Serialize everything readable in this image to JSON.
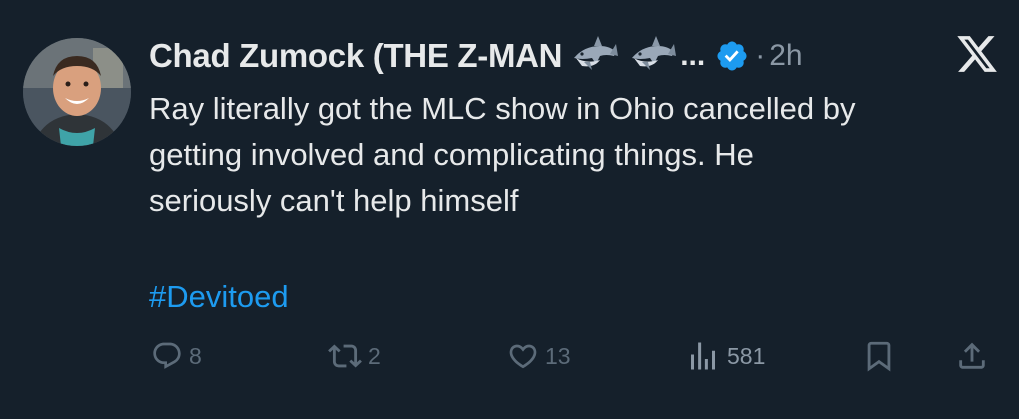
{
  "tweet": {
    "author_name": "Chad Zumock (THE Z-MAN",
    "name_emoji_1": "shark-emoji",
    "name_emoji_2": "shark-emoji",
    "truncation": "...",
    "verified_icon": "verified-badge-icon",
    "separator": "·",
    "timestamp": "2h",
    "platform_logo": "x-logo-icon",
    "body": "Ray literally got the MLC show in Ohio cancelled by\ngetting involved and complicating things. He\nseriously can't help himself",
    "hashtag": "#Devitoed"
  },
  "actions": {
    "reply_count": "8",
    "retweet_count": "2",
    "like_count": "13",
    "views_count": "581",
    "icons": [
      "reply-icon",
      "retweet-icon",
      "like-icon",
      "views-icon",
      "bookmark-icon",
      "share-icon"
    ]
  },
  "colors": {
    "background": "#15202b",
    "text": "#e7e9ea",
    "muted": "#8b98a5",
    "action": "#5c6b79",
    "link": "#1d9bf0",
    "verified": "#1d9bf0"
  }
}
